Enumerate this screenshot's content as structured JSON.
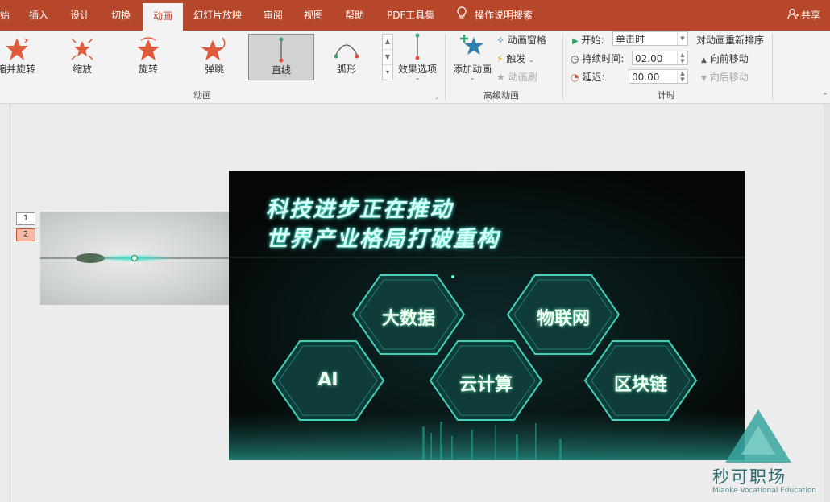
{
  "menu": {
    "tabs": [
      "始",
      "插入",
      "设计",
      "切换",
      "动画",
      "幻灯片放映",
      "审阅",
      "视图",
      "帮助",
      "PDF工具集"
    ],
    "active_tab": "动画",
    "search_label": "操作说明搜索",
    "share_label": "共享"
  },
  "ribbon": {
    "gallery": [
      {
        "label": "缩并旋转",
        "icon": "shrink-spin-star-icon"
      },
      {
        "label": "缩放",
        "icon": "zoom-star-icon"
      },
      {
        "label": "旋转",
        "icon": "spin-star-icon"
      },
      {
        "label": "弹跳",
        "icon": "bounce-star-icon"
      },
      {
        "label": "直线",
        "icon": "line-path-icon",
        "selected": true
      },
      {
        "label": "弧形",
        "icon": "arc-path-icon"
      }
    ],
    "effect_options_label": "效果选项",
    "group_animation_label": "动画",
    "add_animation_label": "添加动画",
    "animation_pane_label": "动画窗格",
    "trigger_label": "触发",
    "animation_painter_label": "动画刷",
    "group_advanced_label": "高级动画",
    "start_label": "开始:",
    "start_value": "单击时",
    "duration_label": "持续时间:",
    "duration_value": "02.00",
    "delay_label": "延迟:",
    "delay_value": "00.00",
    "group_timing_label": "计时",
    "reorder_label": "对动画重新排序",
    "move_earlier_label": "向前移动",
    "move_later_label": "向后移动"
  },
  "workspace": {
    "anim_tags": [
      "1",
      "2"
    ],
    "selected_tag": "2"
  },
  "slide": {
    "title_line1": "科技进步正在推动",
    "title_line2": "世界产业格局打破重构",
    "hexes": [
      "大数据",
      "物联网",
      "AI",
      "云计算",
      "区块链"
    ]
  },
  "watermark": {
    "brand": "秒可职场",
    "sub": "Miaoke Vocational Education"
  },
  "colors": {
    "accent": "#b7472a",
    "glow": "#2fe7d2"
  }
}
